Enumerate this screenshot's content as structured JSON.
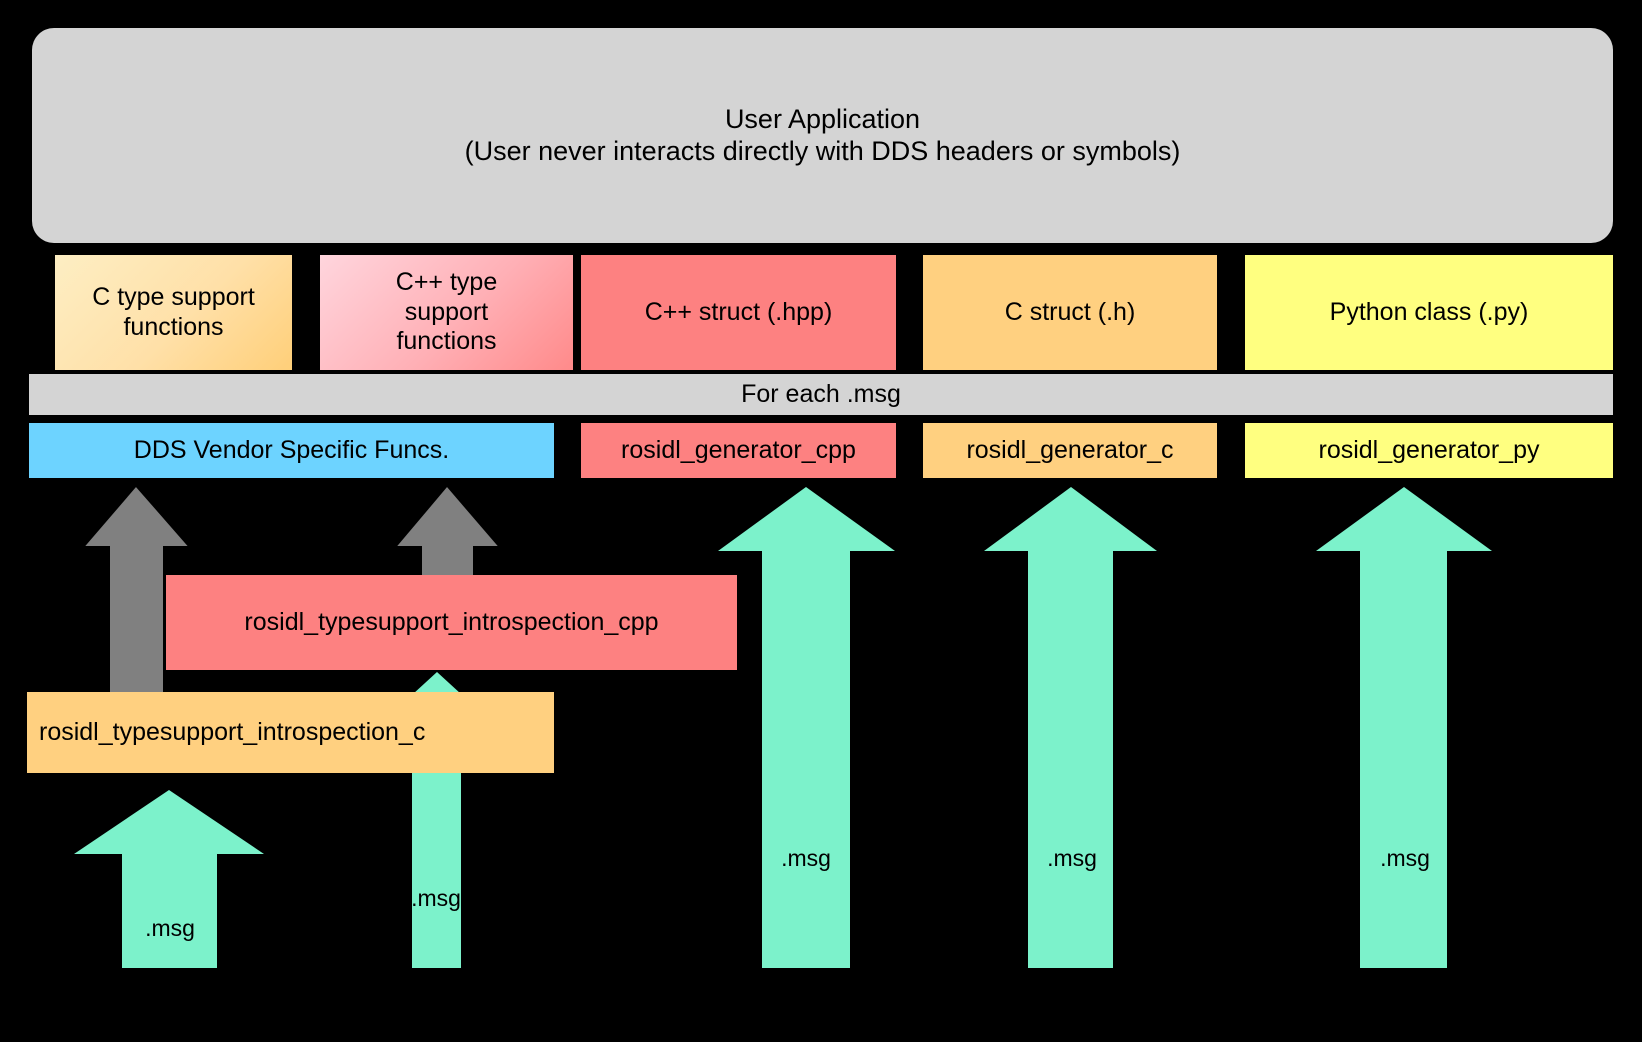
{
  "diagram": {
    "title": "ROS 2 message generation / type support pipeline",
    "background_color": "#000000"
  },
  "user_application": {
    "label": "User Application\n(User never interacts directly with DDS headers or symbols)",
    "color": "#d4d4d4"
  },
  "type_support_row": [
    {
      "id": "c-type-support",
      "label": "C type support\nfunctions",
      "color": "#ffd89a"
    },
    {
      "id": "cpp-type-support",
      "label": "C++ type\nsupport\nfunctions",
      "color": "#ffb0b6"
    },
    {
      "id": "cpp-struct",
      "label": "C++ struct (.hpp)",
      "color": "#fd8181"
    },
    {
      "id": "c-struct",
      "label": "C struct (.h)",
      "color": "#ffd080"
    },
    {
      "id": "py-class",
      "label": "Python class (.py)",
      "color": "#ffff80"
    }
  ],
  "for_each_band": {
    "label": "For each .msg",
    "color": "#d4d4d4"
  },
  "generator_row": [
    {
      "id": "dds-vendor",
      "label": "DDS Vendor Specific Funcs.",
      "color": "#6dd3ff"
    },
    {
      "id": "gen-cpp",
      "label": "rosidl_generator_cpp",
      "color": "#fd8181"
    },
    {
      "id": "gen-c",
      "label": "rosidl_generator_c",
      "color": "#ffd080"
    },
    {
      "id": "gen-py",
      "label": "rosidl_generator_py",
      "color": "#ffff80"
    }
  ],
  "introspection": [
    {
      "id": "introspection-cpp",
      "label": "rosidl_typesupport_introspection_cpp",
      "color": "#fd8181"
    },
    {
      "id": "introspection-c",
      "label": "rosidl_typesupport_introspection_c",
      "color": "#ffd080"
    }
  ],
  "arrows": {
    "gray_color": "#808080",
    "green_color": "#7cf2cb",
    "msg_labels": {
      "a": ".msg",
      "b": ".msg",
      "c": ".msg",
      "d": ".msg",
      "e": ".msg"
    }
  }
}
